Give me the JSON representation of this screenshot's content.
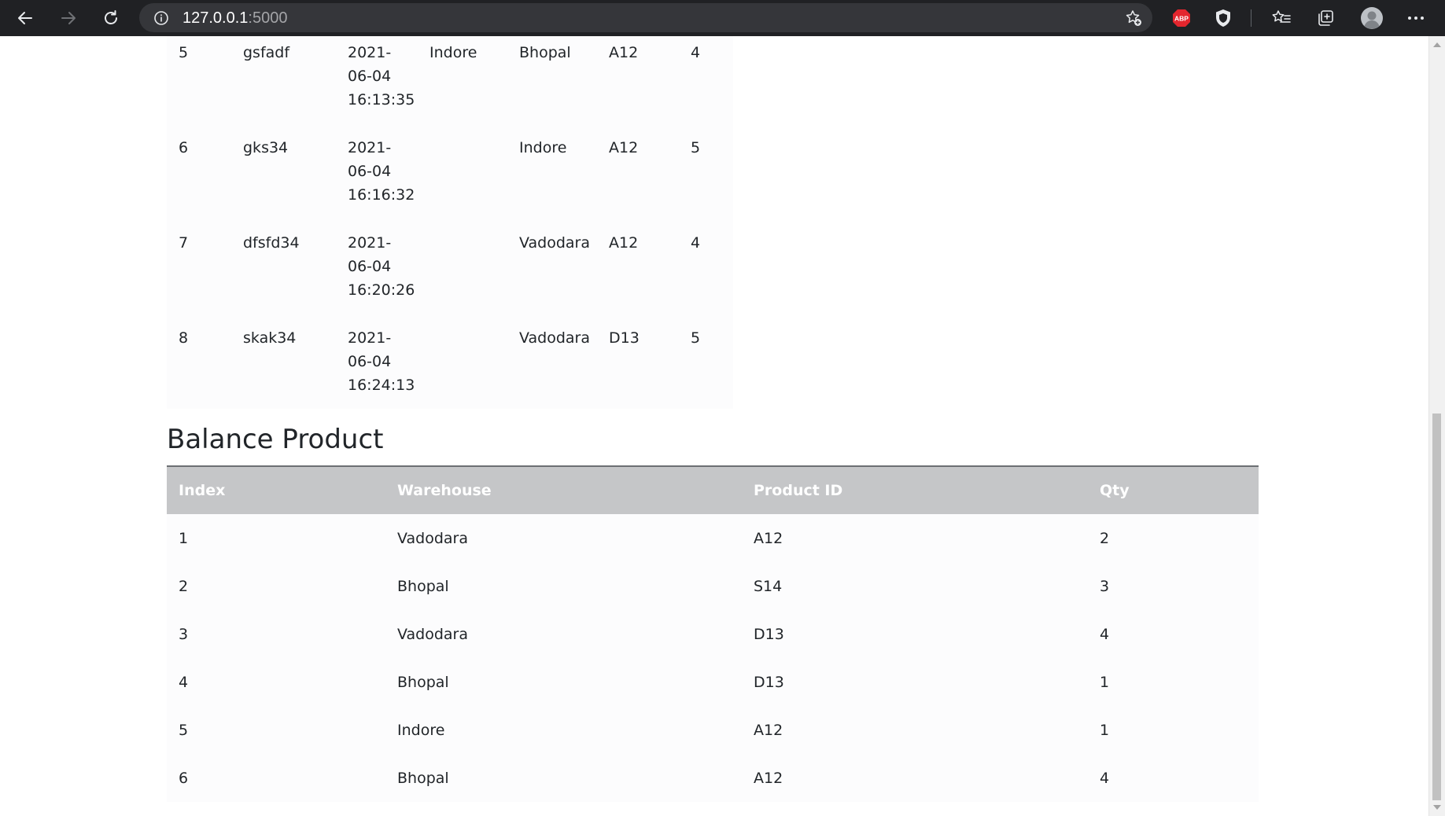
{
  "browser": {
    "url_host": "127.0.0.1",
    "url_port": ":5000",
    "icons": {
      "back": "back-arrow-icon",
      "forward": "forward-arrow-icon",
      "reload": "reload-icon",
      "info": "info-icon",
      "add_favorite": "star-add-icon",
      "adblock": "adblock-plus-icon",
      "shield": "shield-extension-icon",
      "favorites": "favorites-list-icon",
      "collections": "collections-icon",
      "profile": "profile-avatar-icon",
      "more": "more-menu-icon"
    },
    "adblock_label": "ABP"
  },
  "orders_table": {
    "rows": [
      {
        "index": "5",
        "order_id": "gsfadf",
        "date": "2021-",
        "date_mid": "06-04",
        "time": "16:13:35",
        "from": "Indore",
        "to": "Bhopal",
        "product": "A12",
        "qty": "4"
      },
      {
        "index": "6",
        "order_id": "gks34",
        "date": "2021-",
        "date_mid": "06-04",
        "time": "16:16:32",
        "from": "",
        "to": "Indore",
        "product": "A12",
        "qty": "5"
      },
      {
        "index": "7",
        "order_id": "dfsfd34",
        "date": "2021-",
        "date_mid": "06-04",
        "time": "16:20:26",
        "from": "",
        "to": "Vadodara",
        "product": "A12",
        "qty": "4"
      },
      {
        "index": "8",
        "order_id": "skak34",
        "date": "2021-",
        "date_mid": "06-04",
        "time": "16:24:13",
        "from": "",
        "to": "Vadodara",
        "product": "D13",
        "qty": "5"
      }
    ]
  },
  "balance": {
    "title": "Balance Product",
    "columns": [
      "Index",
      "Warehouse",
      "Product ID",
      "Qty"
    ],
    "rows": [
      {
        "index": "1",
        "warehouse": "Vadodara",
        "product_id": "A12",
        "qty": "2"
      },
      {
        "index": "2",
        "warehouse": "Bhopal",
        "product_id": "S14",
        "qty": "3"
      },
      {
        "index": "3",
        "warehouse": "Vadodara",
        "product_id": "D13",
        "qty": "4"
      },
      {
        "index": "4",
        "warehouse": "Bhopal",
        "product_id": "D13",
        "qty": "1"
      },
      {
        "index": "5",
        "warehouse": "Indore",
        "product_id": "A12",
        "qty": "1"
      },
      {
        "index": "6",
        "warehouse": "Bhopal",
        "product_id": "A12",
        "qty": "4"
      }
    ]
  }
}
